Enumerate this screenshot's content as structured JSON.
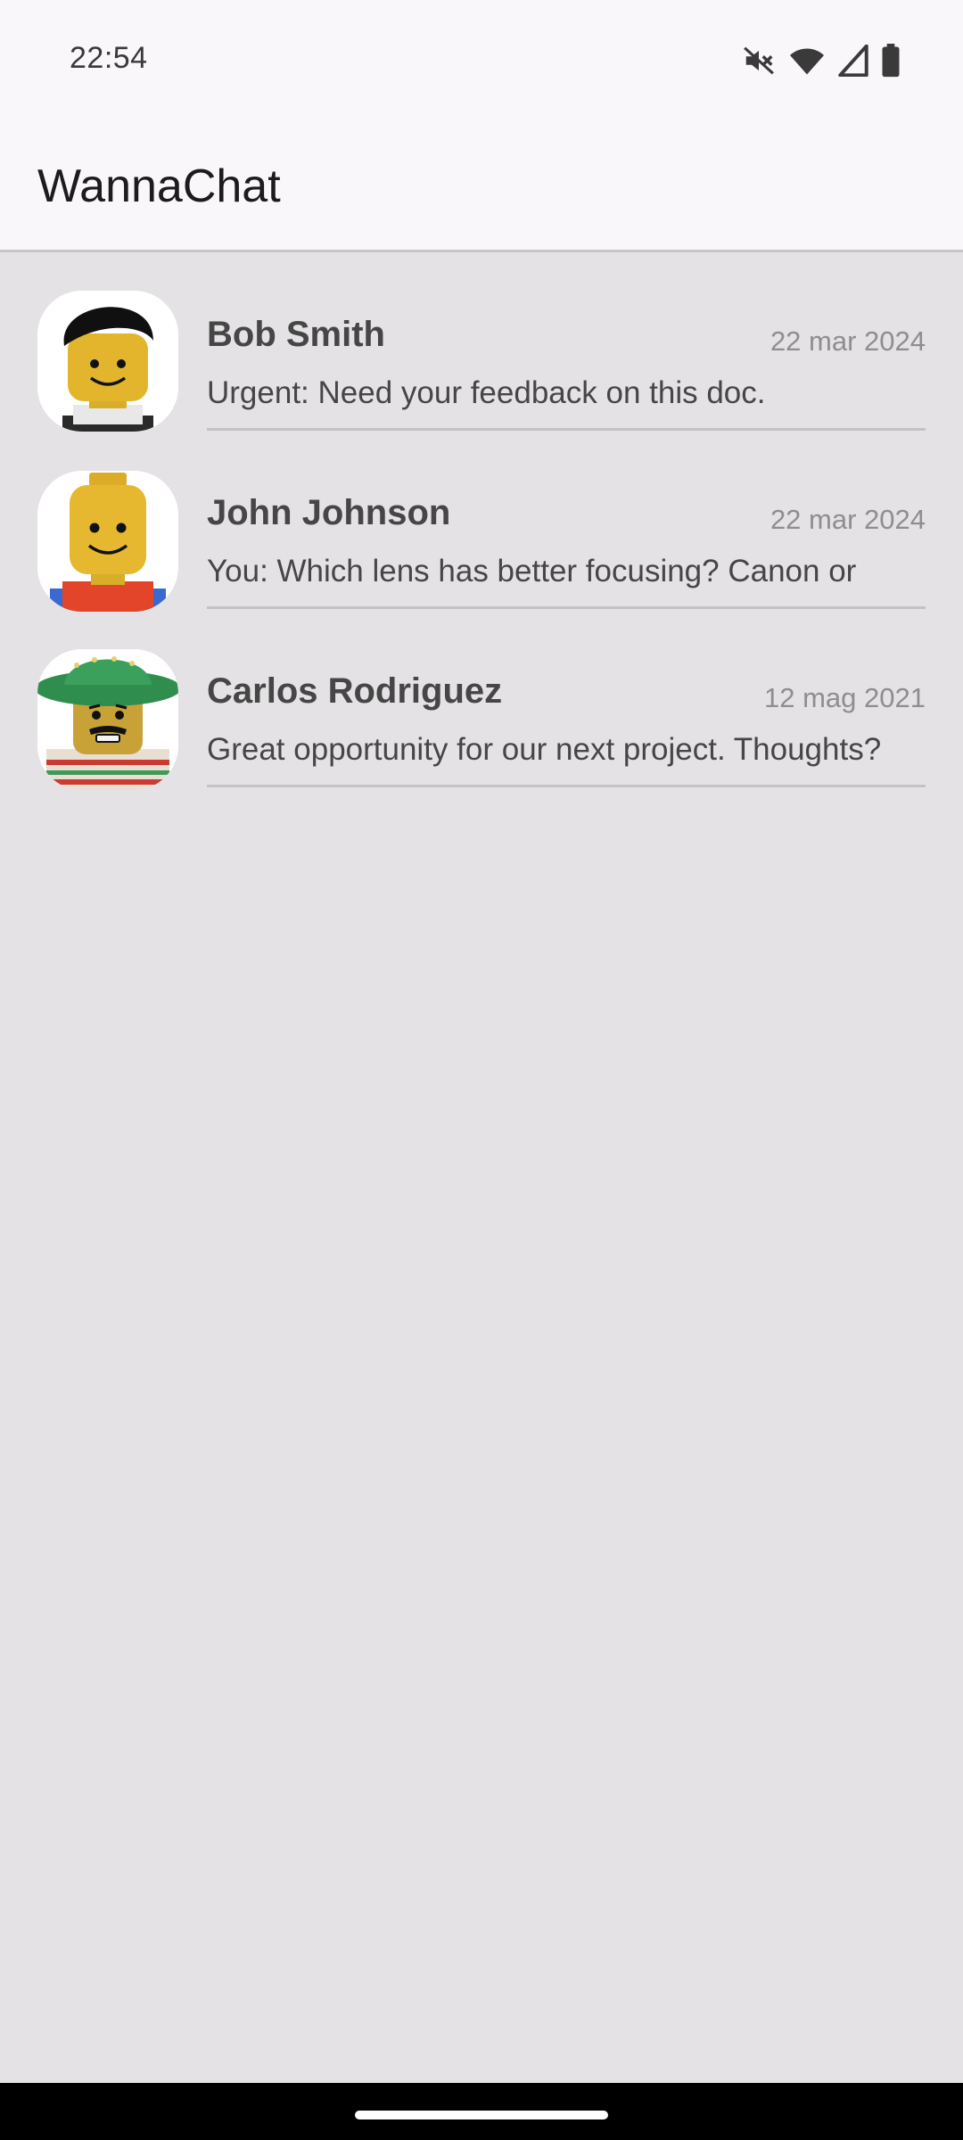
{
  "status_bar": {
    "time": "22:54",
    "icons": [
      "mute-icon",
      "wifi-icon",
      "cellular-signal-icon",
      "battery-icon"
    ]
  },
  "app_bar": {
    "title": "WannaChat"
  },
  "chats": [
    {
      "name": "Bob Smith",
      "date": "22 mar 2024",
      "preview": "Urgent: Need your feedback on this doc.",
      "avatar": "lego-minifig-black-hair-avatar"
    },
    {
      "name": "John Johnson",
      "date": "22 mar 2024",
      "preview": "You: Which lens has better focusing? Canon or",
      "avatar": "lego-minifig-classic-avatar"
    },
    {
      "name": "Carlos Rodriguez",
      "date": "12 mag 2021",
      "preview": "Great opportunity for our next project. Thoughts?",
      "avatar": "lego-minifig-sombrero-avatar"
    }
  ],
  "colors": {
    "background": "#e4e2e4",
    "app_bar": "#f9f7f9",
    "name_text": "#464646",
    "date_text": "#8e8e8e",
    "divider": "#c4c2c4"
  }
}
